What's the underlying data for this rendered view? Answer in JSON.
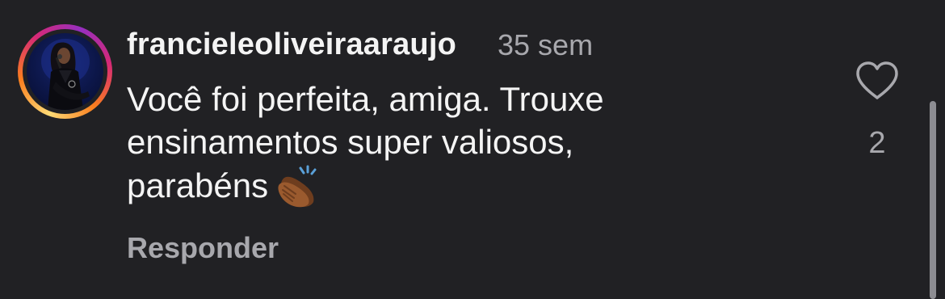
{
  "comment": {
    "username": "francieleoliveiraaraujo",
    "time": "35 sem",
    "text_lines": [
      "Você foi perfeita, amiga. Trouxe",
      "ensinamentos super valiosos,",
      "parabéns"
    ],
    "emoji": "👏🏾",
    "reply_label": "Responder",
    "like_count": "2",
    "like_icon": "heart-outline-icon"
  },
  "colors": {
    "background": "#212124",
    "primary_text": "#f4f4f4",
    "secondary_text": "#a8a8ad"
  }
}
